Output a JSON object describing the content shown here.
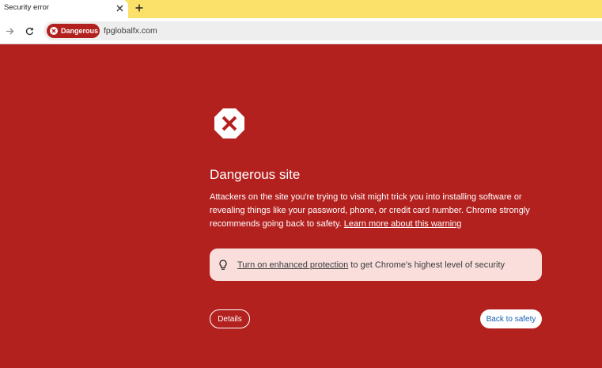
{
  "browser": {
    "tab": {
      "title": "Security error"
    },
    "address_bar": {
      "security_chip": "Dangerous",
      "url": "fpglobalfx.com"
    }
  },
  "interstitial": {
    "heading": "Dangerous site",
    "body_text": "Attackers on the site you're trying to visit might trick you into installing software or revealing things like your password, phone, or credit card number. Chrome strongly recommends going back to safety. ",
    "learn_more_link": "Learn more about this warning",
    "enhanced_protection": {
      "link": "Turn on enhanced protection",
      "text": " to get Chrome's highest level of security"
    },
    "details_button": "Details",
    "back_to_safety_button": "Back to safety"
  },
  "icons": {
    "tab_close": "close-icon",
    "new_tab": "plus-icon",
    "forward": "forward-arrow-icon",
    "reload": "reload-icon",
    "chip": "danger-x-icon",
    "warning": "stop-sign-x-icon",
    "tip": "lightbulb-icon"
  },
  "colors": {
    "danger_background": "#b3211f",
    "tab_strip": "#fbe06a",
    "pill_background": "#f9dedc",
    "link_blue": "#1a5fb4"
  }
}
